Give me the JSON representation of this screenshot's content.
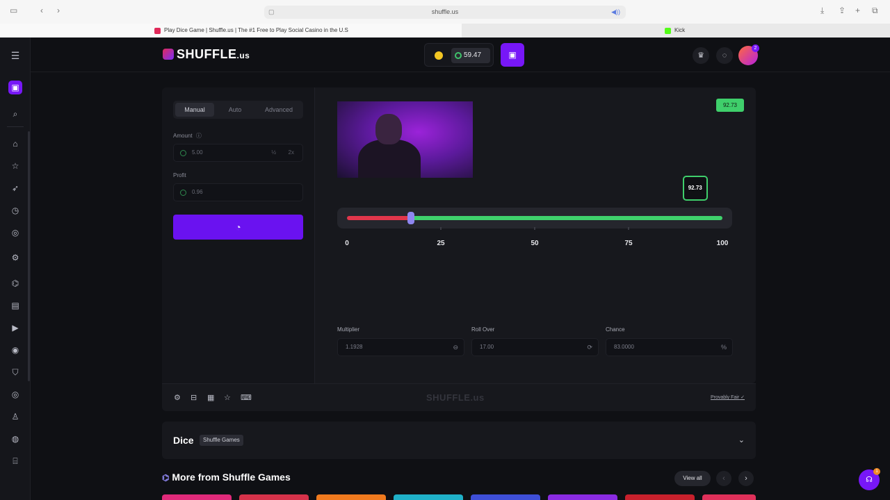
{
  "browser": {
    "url": "shuffle.us",
    "tabs": [
      {
        "label": "Play Dice Game | Shuffle.us | The #1 Free to Play Social Casino in the U.S"
      },
      {
        "label": "Kick"
      }
    ]
  },
  "header": {
    "logo_text": "SHUFFLE",
    "logo_suffix": ".us",
    "balance": "59.47",
    "avatar_badge": "2"
  },
  "bet_panel": {
    "tabs": [
      "Manual",
      "Auto",
      "Advanced"
    ],
    "active_tab": "Manual",
    "amount_label": "Amount",
    "amount_value": "5.00",
    "half_label": "½",
    "double_label": "2x",
    "profit_label": "Profit",
    "profit_value": "0.96"
  },
  "game": {
    "result_pill": "92.73",
    "marker_value": "92.73",
    "slider": {
      "min": 0,
      "max": 100,
      "value": 17,
      "ticks": [
        "0",
        "25",
        "50",
        "75",
        "100"
      ]
    },
    "multiplier_label": "Multiplier",
    "multiplier_value": "1.1928",
    "roll_over_label": "Roll Over",
    "roll_over_value": "17.00",
    "chance_label": "Chance",
    "chance_value": "83.0000",
    "chance_unit": "%"
  },
  "footer": {
    "watermark": "SHUFFLE.us",
    "provably_fair": "Provably Fair"
  },
  "info": {
    "title": "Dice",
    "badge": "Shuffle Games"
  },
  "more": {
    "title": "More from Shuffle Games",
    "view_all": "View all"
  },
  "support_badge": "1",
  "colors": {
    "accent": "#7717f7",
    "win_green": "#3fd16c",
    "lose_red": "#e1364b"
  }
}
